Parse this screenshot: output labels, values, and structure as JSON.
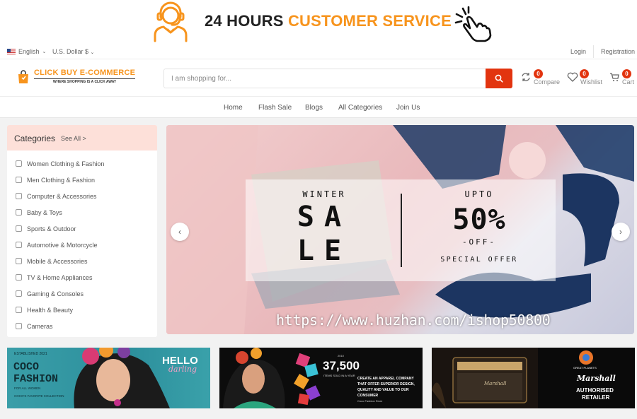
{
  "promo": {
    "text_1": "24 HOURS",
    "text_2": "CUSTOMER SERVICE"
  },
  "topbar": {
    "language": "English",
    "currency": "U.S. Dollar $",
    "login": "Login",
    "register": "Registration"
  },
  "brand": {
    "name": "CLICK BUY E-COMMERCE",
    "tagline": "WHERE SHOPPING IS A CLICK AWAY"
  },
  "search": {
    "placeholder": "I am shopping for..."
  },
  "header_icons": [
    {
      "name": "compare-icon",
      "label": "Compare",
      "count": "0"
    },
    {
      "name": "heart-icon",
      "label": "Wishlist",
      "count": "0"
    },
    {
      "name": "cart-icon",
      "label": "Cart",
      "count": "0"
    }
  ],
  "nav": [
    "Home",
    "Flash Sale",
    "Blogs",
    "All Categories",
    "Join Us"
  ],
  "categories": {
    "title": "Categories",
    "see_all": "See All >",
    "items": [
      "Women Clothing & Fashion",
      "Men Clothing & Fashion",
      "Computer & Accessories",
      "Baby & Toys",
      "Sports & Outdoor",
      "Automotive & Motorcycle",
      "Mobile & Accessories",
      "TV & Home Appliances",
      "Gaming & Consoles",
      "Health & Beauty",
      "Cameras"
    ]
  },
  "hero": {
    "left_top": "WINTER",
    "left_big_1": "SA",
    "left_big_2": "LE",
    "right_top": "UPTO",
    "right_big": "50%",
    "right_off": "-OFF-",
    "right_bottom": "SPECIAL OFFER",
    "watermark": "https://www.huzhan.com/ishop50800"
  },
  "banners": {
    "b1": {
      "brand_1": "COCO",
      "brand_2": "FASHION",
      "small_top": "ESTABLISHED 2021",
      "small_mid": "FOR ALL WOMEN",
      "small_bottom": "COCO'S FAVORITE COLLECTION",
      "hello": "HELLO",
      "darling": "darling"
    },
    "b2": {
      "since": "2010",
      "number": "37,500",
      "items": "ITEMS SOLD IN A YEAR",
      "copy": "CREATE AN APPAREL COMPANY THAT OFFER SUPERIOR DESIGN, QUALITY AND VALUE TO OUR CONSUMER",
      "store": "Coco Fashion Store"
    },
    "b3": {
      "amp": "Marshall",
      "badge": "GREAT PLANETS",
      "script": "Marshall",
      "line1": "AUTHORISED",
      "line2": "RETAILER"
    }
  }
}
